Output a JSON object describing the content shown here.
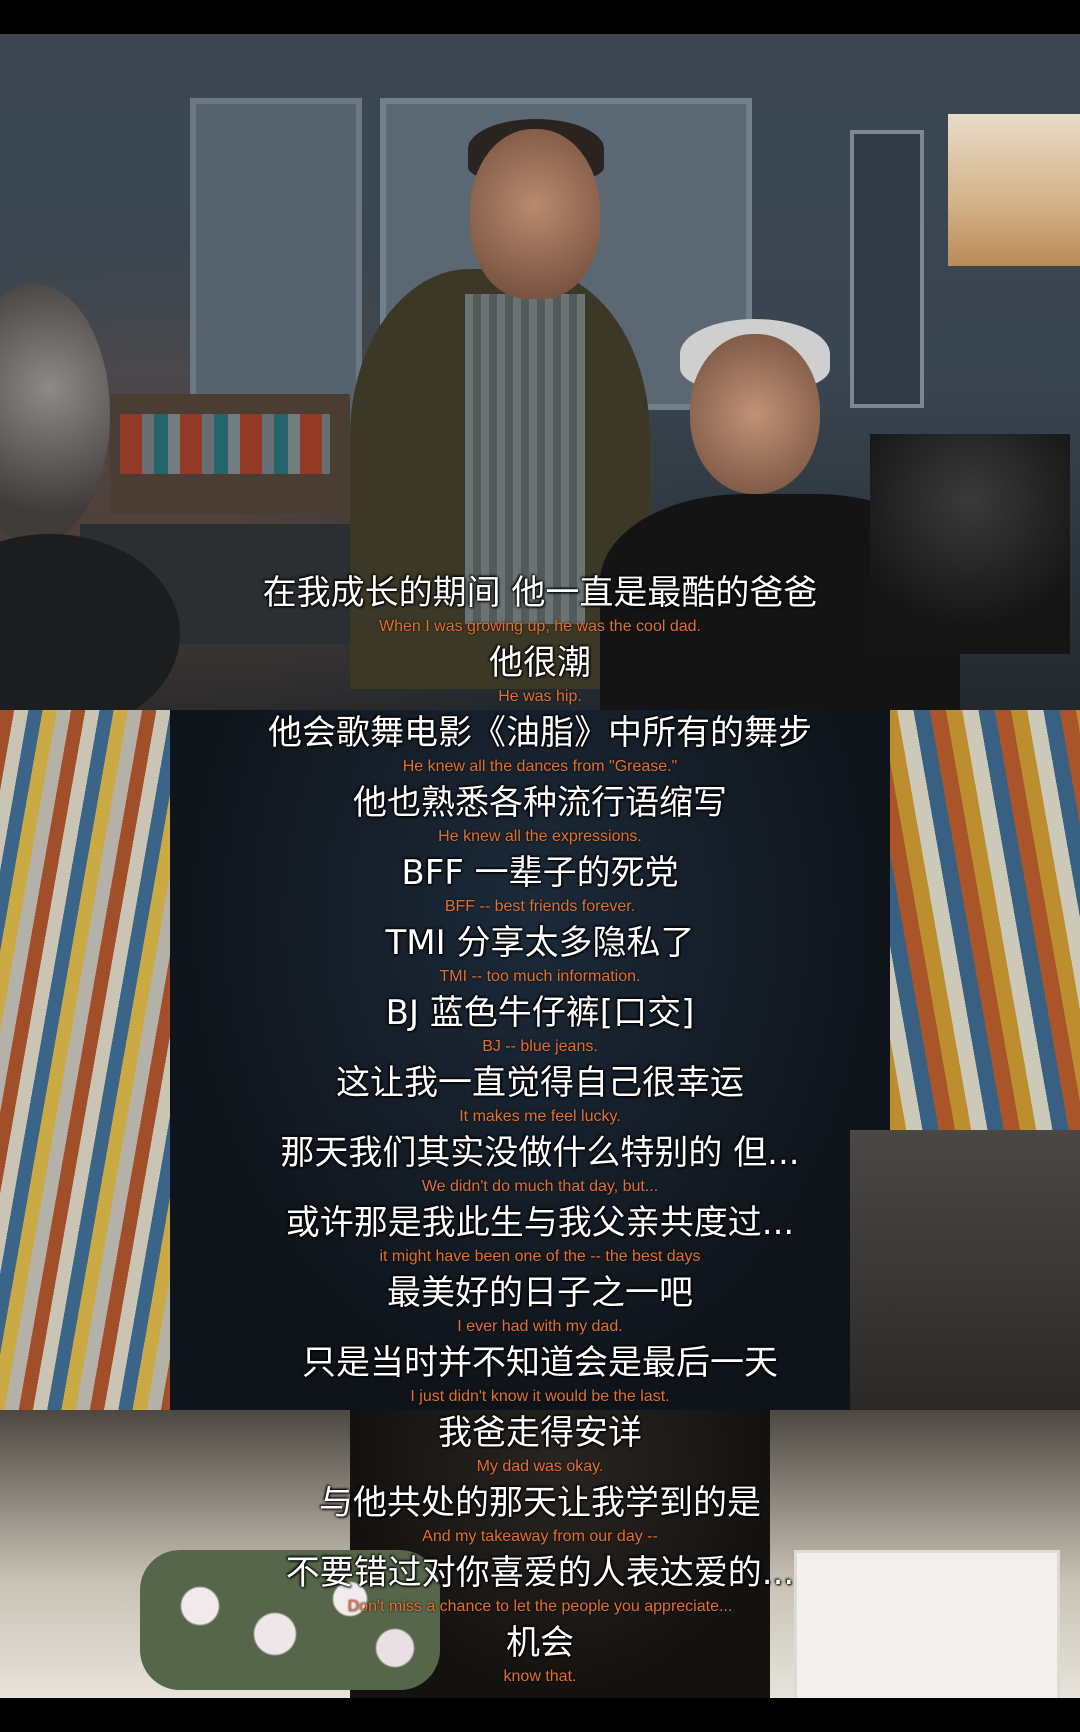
{
  "subtitles": [
    {
      "zh": "在我成长的期间  他一直是最酷的爸爸",
      "en": "When I was growing up, he was the cool dad."
    },
    {
      "zh": "他很潮",
      "en": "He was hip."
    },
    {
      "zh": "他会歌舞电影《油脂》中所有的舞步",
      "en": "He knew all the dances from \"Grease.\""
    },
    {
      "zh": "他也熟悉各种流行语缩写",
      "en": "He knew all the expressions."
    },
    {
      "zh": "BFF  一辈子的死党",
      "en": "BFF -- best friends forever."
    },
    {
      "zh": "TMI  分享太多隐私了",
      "en": "TMI -- too much information."
    },
    {
      "zh": "BJ  蓝色牛仔裤[口交]",
      "en": "BJ -- blue jeans."
    },
    {
      "zh": "这让我一直觉得自己很幸运",
      "en": "It makes me feel lucky."
    },
    {
      "zh": "那天我们其实没做什么特别的  但...",
      "en": "We didn't do much that day, but..."
    },
    {
      "zh": "或许那是我此生与我父亲共度过...",
      "en": "it might have been one of the -- the best days"
    },
    {
      "zh": "最美好的日子之一吧",
      "en": "I ever had with my dad."
    },
    {
      "zh": "只是当时并不知道会是最后一天",
      "en": "I just didn't know it would be the last."
    },
    {
      "zh": "我爸走得安详",
      "en": "My dad was okay."
    },
    {
      "zh": "与他共处的那天让我学到的是",
      "en": "And my takeaway from our day --"
    },
    {
      "zh": "不要错过对你喜爱的人表达爱的...",
      "en": "Don't miss a chance to let the people you appreciate..."
    },
    {
      "zh": "机会",
      "en": "know that."
    }
  ],
  "colors": {
    "zh_text": "#ffffff",
    "en_text": "#e0712f",
    "border": "#000000"
  }
}
